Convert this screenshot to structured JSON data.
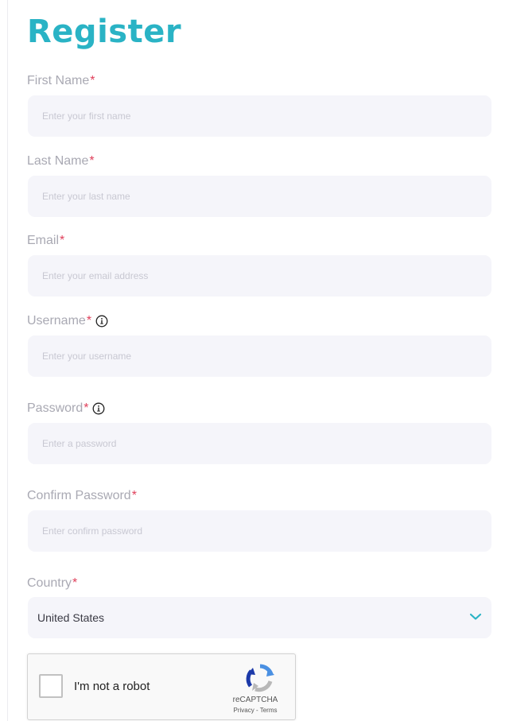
{
  "form": {
    "title": "Register",
    "required_mark": "*",
    "fields": [
      {
        "label": "First Name",
        "placeholder": "Enter your first name"
      },
      {
        "label": "Last Name",
        "placeholder": "Enter your last name"
      },
      {
        "label": "Email",
        "placeholder": "Enter your email address"
      },
      {
        "label": "Username ",
        "placeholder": "Enter your username"
      },
      {
        "label": "Password ",
        "placeholder": "Enter a password"
      },
      {
        "label": "Confirm Password",
        "placeholder": "Enter confirm password"
      }
    ],
    "country": {
      "label": "Country",
      "selected": "United States"
    }
  },
  "captcha": {
    "label": "I'm not a robot",
    "brand": "reCAPTCHA",
    "privacy": "Privacy",
    "separator": " - ",
    "terms": "Terms"
  },
  "colors": {
    "accent": "#2ab3c5",
    "required": "#e0405b",
    "field_bg": "#f5f5fa",
    "label": "#a9a9b3"
  },
  "icons": {
    "info": "info-circle-icon",
    "dropdown": "chevron-down-icon",
    "captcha_logo": "recaptcha-logo-icon"
  }
}
